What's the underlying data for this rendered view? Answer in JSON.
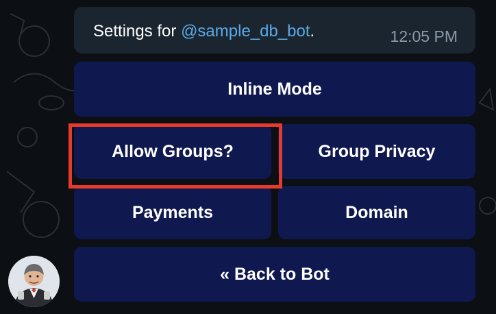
{
  "message": {
    "prefix": "Settings for ",
    "mention": "@sample_db_bot",
    "suffix": ".",
    "time": "12:05 PM"
  },
  "keyboard": {
    "inline_mode": "Inline Mode",
    "allow_groups": "Allow Groups?",
    "group_privacy": "Group Privacy",
    "payments": "Payments",
    "domain": "Domain",
    "back_to_bot": "« Back to Bot"
  },
  "colors": {
    "button_bg": "#10194f",
    "bubble_bg": "#1b2530",
    "mention": "#5aaae8",
    "highlight": "#e53a2c"
  }
}
